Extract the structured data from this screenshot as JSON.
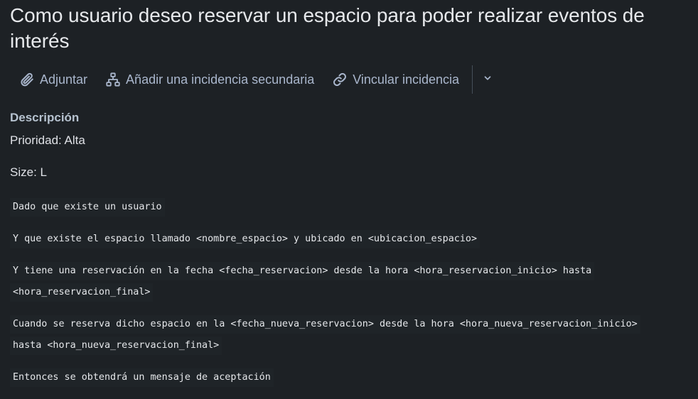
{
  "issue": {
    "title": "Como usuario deseo reservar un espacio para poder realizar eventos de interés"
  },
  "toolbar": {
    "attach_label": "Adjuntar",
    "child_issue_label": "Añadir una incidencia secundaria",
    "link_issue_label": "Vincular incidencia",
    "icons": {
      "attach": "paperclip-icon",
      "child_issue": "hierarchy-icon",
      "link_issue": "link-icon",
      "more": "chevron-down-icon"
    }
  },
  "description": {
    "heading": "Descripción",
    "priority": "Prioridad: Alta",
    "size": "Size: L",
    "lines": [
      "Dado que existe un usuario",
      "Y que existe el espacio llamado <nombre_espacio> y ubicado en <ubicacion_espacio>",
      "Y tiene una reservación en la fecha <fecha_reservacion> desde la hora <hora_reservacion_inicio> hasta",
      "<hora_reservacion_final>",
      "Cuando se reserva dicho espacio en la <fecha_nueva_reservacion> desde la hora <hora_nueva_reservacion_inicio>",
      "hasta <hora_nueva_reservacion_final>",
      "Entonces se obtendrá un mensaje de aceptación"
    ]
  },
  "colors": {
    "background": "#1d2125",
    "text": "#dfe1e6",
    "toolbar_text": "#a9b6cc",
    "heading": "#b6c2cf"
  }
}
